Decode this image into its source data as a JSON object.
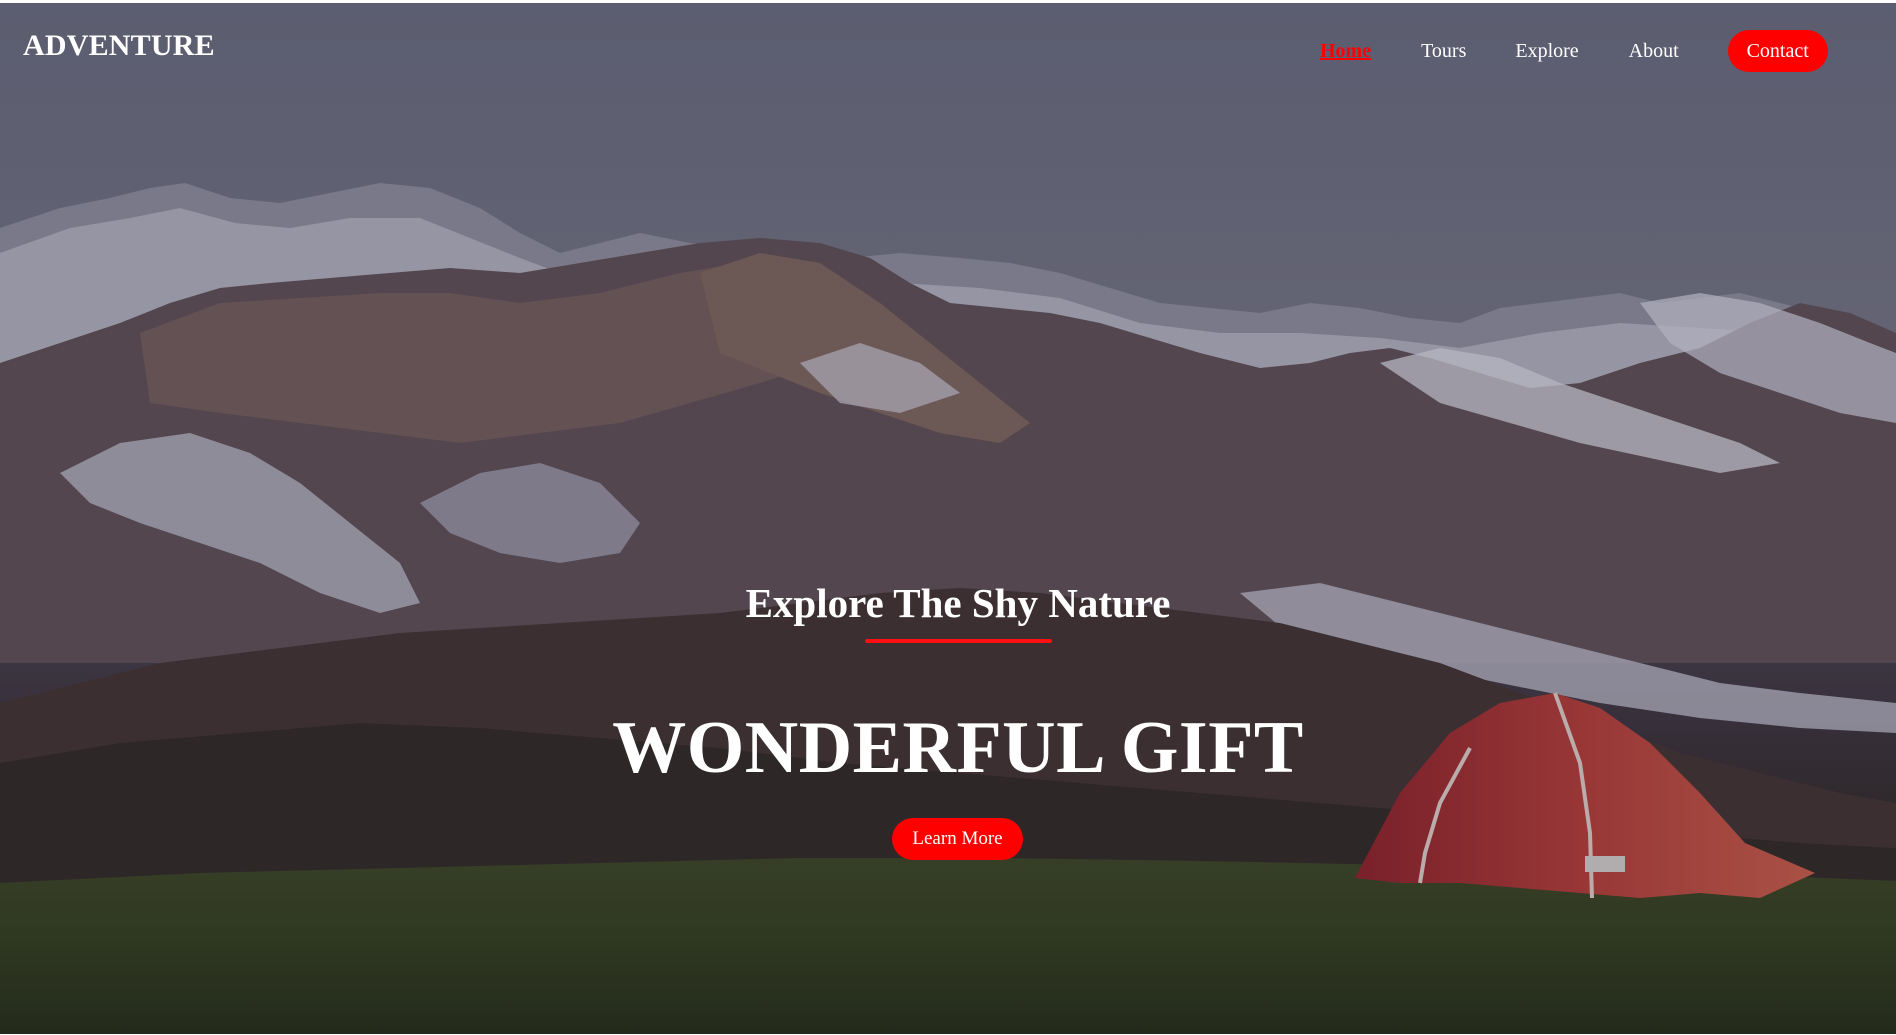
{
  "brand": {
    "logo_text": "ADVENTURE"
  },
  "nav": {
    "items": [
      {
        "label": "Home",
        "active": true
      },
      {
        "label": "Tours"
      },
      {
        "label": "Explore"
      },
      {
        "label": "About"
      }
    ],
    "contact_label": "Contact"
  },
  "hero": {
    "subtitle": "Explore The Shy Nature",
    "headline": "WONDERFUL GIFT",
    "cta_label": "Learn More",
    "background_image": "mountain landscape with red tent"
  },
  "colors": {
    "accent": "#ff0000",
    "text": "#ffffff"
  }
}
